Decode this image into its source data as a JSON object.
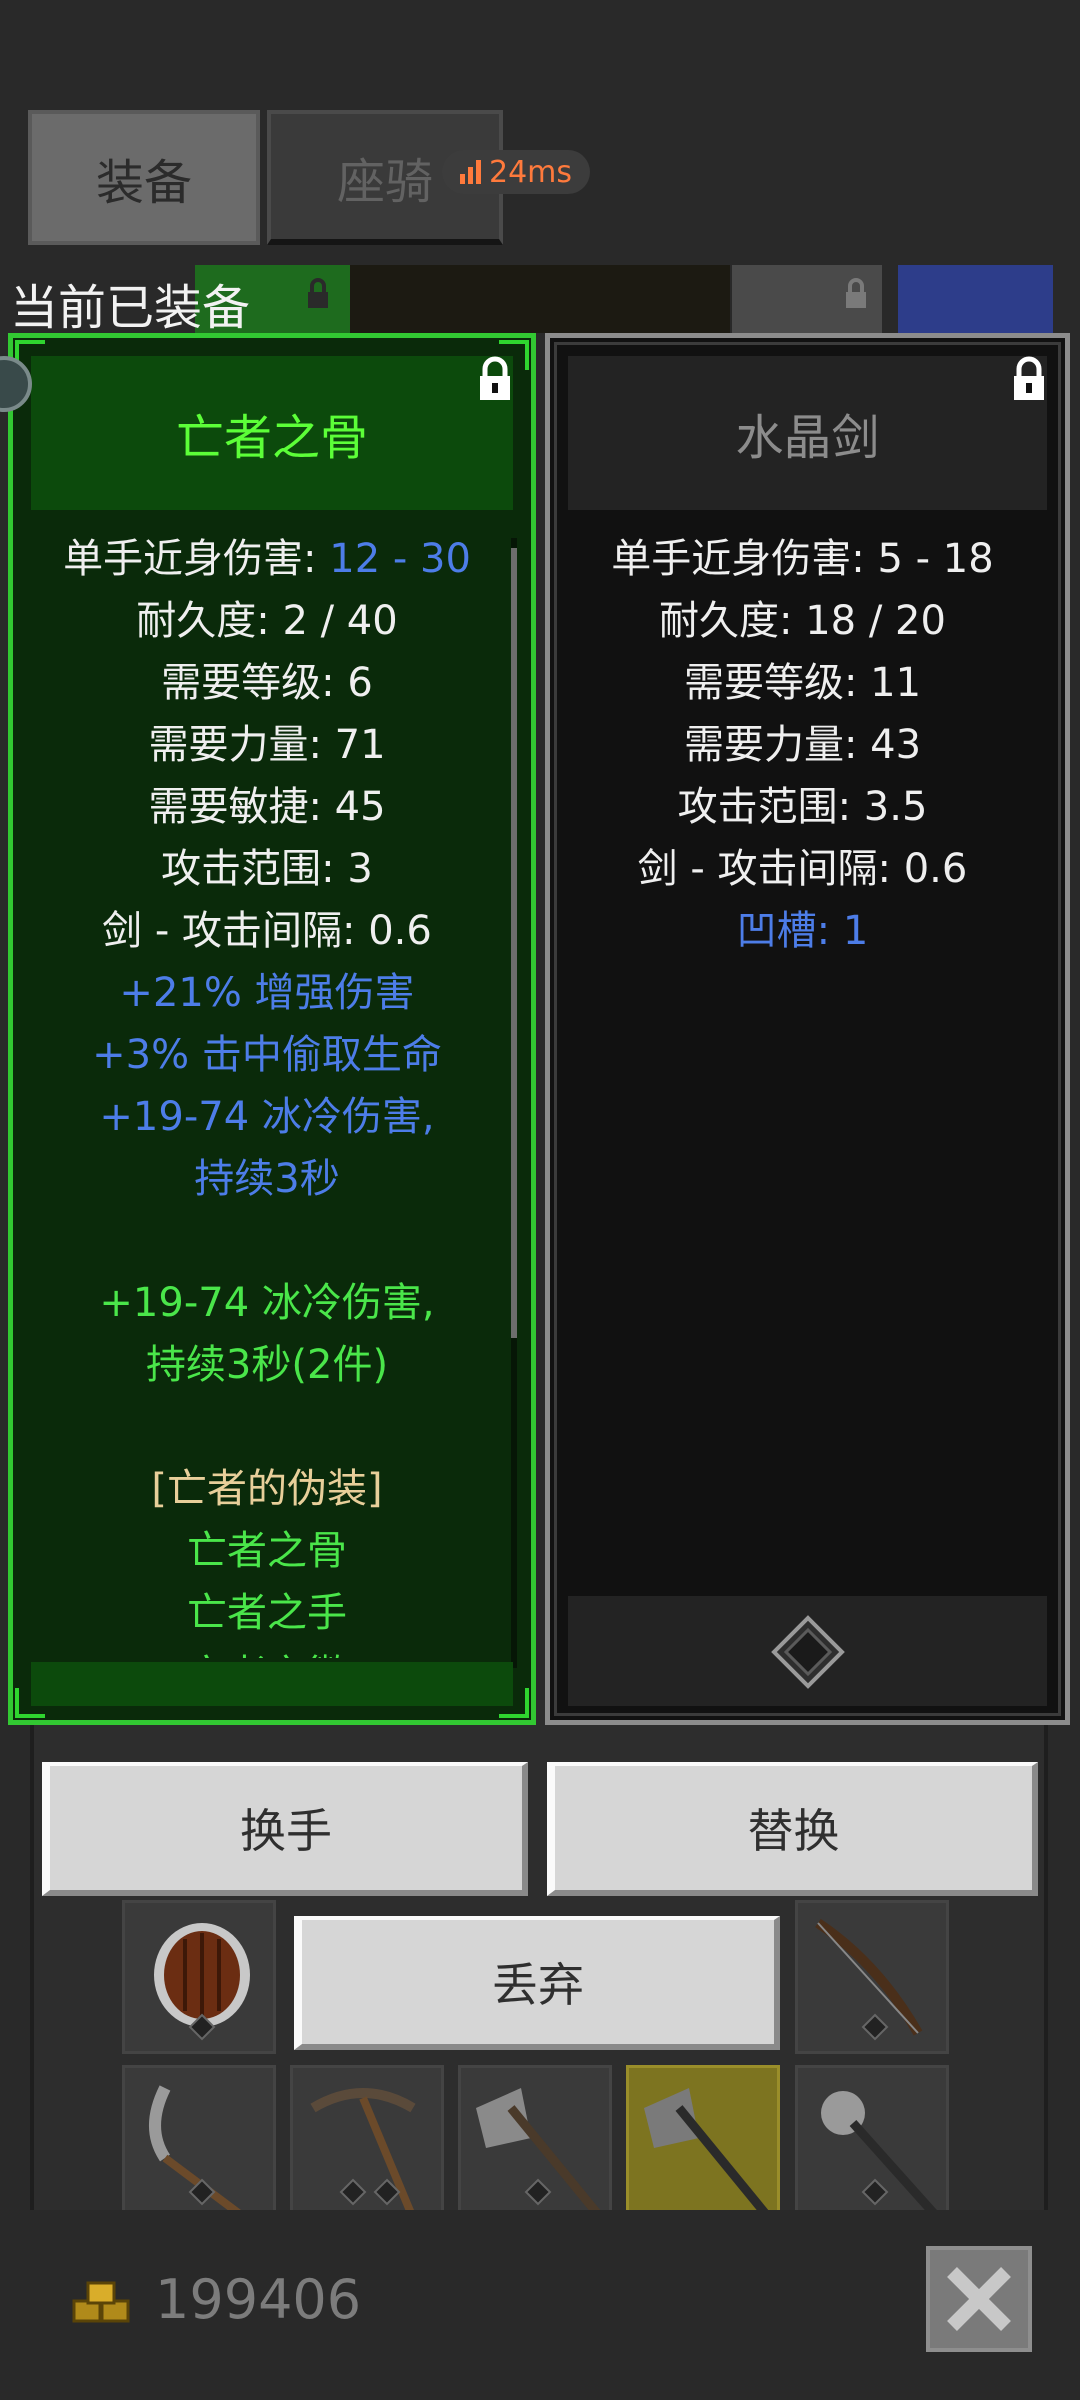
{
  "tabs": {
    "equipment": "装备",
    "mount": "座骑"
  },
  "ping": {
    "value": "24ms",
    "color": "#ff7a3c"
  },
  "current_equipped_label": "当前已装备",
  "left_item": {
    "name": "亡者之骨",
    "color": "#5cff38",
    "stats": {
      "damage_label": "单手近身伤害: ",
      "damage_value": "12 - 30",
      "durability": "耐久度: 2 / 40",
      "req_level": "需要等级: 6",
      "req_str": "需要力量: 71",
      "req_dex": "需要敏捷: 45",
      "range": "攻击范围: 3",
      "interval": "剑 - 攻击间隔: 0.6",
      "mod1": "+21% 增强伤害",
      "mod2": "+3% 击中偷取生命",
      "mod3a": "+19-74 冰冷伤害,",
      "mod3b": "持续3秒",
      "set_bonus_a": "+19-74 冰冷伤害,",
      "set_bonus_b": "持续3秒(2件)",
      "set_name": "[亡者的伪装]",
      "set_item1": "亡者之骨",
      "set_item2": "亡者之手",
      "set_item3": "亡者之徽"
    }
  },
  "right_item": {
    "name": "水晶剑",
    "color": "#8c8c8c",
    "stats": {
      "damage": "单手近身伤害: 5 - 18",
      "durability": "耐久度: 18 / 20",
      "req_level": "需要等级: 11",
      "req_str": "需要力量: 43",
      "range": "攻击范围: 3.5",
      "interval": "剑 - 攻击间隔: 0.6",
      "socket": "凹槽: 1"
    }
  },
  "buttons": {
    "swap_hand": "换手",
    "replace": "替换",
    "discard": "丢弃"
  },
  "gold": {
    "amount": "199406"
  },
  "icons": {
    "lock": "lock-icon",
    "socket": "diamond-socket-icon",
    "coins": "gold-coins-icon",
    "close": "close-x-icon"
  }
}
